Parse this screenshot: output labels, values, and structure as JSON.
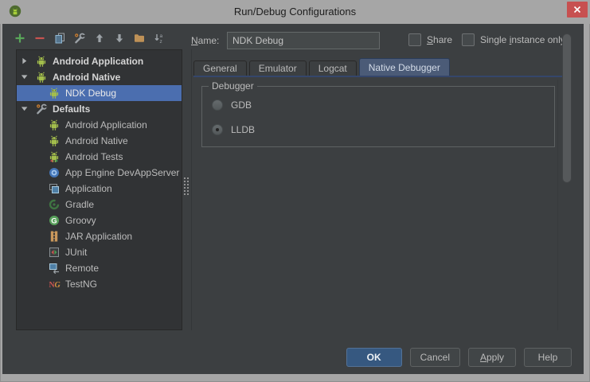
{
  "window": {
    "title": "Run/Debug Configurations"
  },
  "toolbar": {
    "buttons": [
      {
        "name": "add",
        "icon": "add-icon"
      },
      {
        "name": "remove",
        "icon": "remove-icon"
      },
      {
        "name": "copy-configuration",
        "icon": "copy-icon"
      },
      {
        "name": "edit-defaults",
        "icon": "settings-wrench-icon"
      },
      {
        "name": "move-up",
        "icon": "arrow-up-icon"
      },
      {
        "name": "move-down",
        "icon": "arrow-down-icon"
      },
      {
        "name": "new-folder",
        "icon": "folder-icon"
      },
      {
        "name": "sort-alphabetically",
        "icon": "sort-alpha-icon"
      }
    ]
  },
  "tree": {
    "items": [
      {
        "label": "Android Application",
        "icon": "android-icon",
        "bold": true,
        "level": 0,
        "expander": "collapsed",
        "selected": false
      },
      {
        "label": "Android Native",
        "icon": "android-icon",
        "bold": true,
        "level": 0,
        "expander": "expanded",
        "selected": false
      },
      {
        "label": "NDK Debug",
        "icon": "android-icon",
        "bold": false,
        "level": 1,
        "expander": "none",
        "selected": true
      },
      {
        "label": "Defaults",
        "icon": "settings-wrench-icon",
        "bold": true,
        "level": 0,
        "expander": "expanded",
        "selected": false
      },
      {
        "label": "Android Application",
        "icon": "android-icon",
        "bold": false,
        "level": 1,
        "expander": "none",
        "selected": false
      },
      {
        "label": "Android Native",
        "icon": "android-icon",
        "bold": false,
        "level": 1,
        "expander": "none",
        "selected": false
      },
      {
        "label": "Android Tests",
        "icon": "android-tests-icon",
        "bold": false,
        "level": 1,
        "expander": "none",
        "selected": false
      },
      {
        "label": "App Engine DevAppServer",
        "icon": "app-engine-icon",
        "bold": false,
        "level": 1,
        "expander": "none",
        "selected": false
      },
      {
        "label": "Application",
        "icon": "application-icon",
        "bold": false,
        "level": 1,
        "expander": "none",
        "selected": false
      },
      {
        "label": "Gradle",
        "icon": "gradle-icon",
        "bold": false,
        "level": 1,
        "expander": "none",
        "selected": false
      },
      {
        "label": "Groovy",
        "icon": "groovy-icon",
        "bold": false,
        "level": 1,
        "expander": "none",
        "selected": false
      },
      {
        "label": "JAR Application",
        "icon": "jar-icon",
        "bold": false,
        "level": 1,
        "expander": "none",
        "selected": false
      },
      {
        "label": "JUnit",
        "icon": "junit-icon",
        "bold": false,
        "level": 1,
        "expander": "none",
        "selected": false
      },
      {
        "label": "Remote",
        "icon": "remote-icon",
        "bold": false,
        "level": 1,
        "expander": "none",
        "selected": false
      },
      {
        "label": "TestNG",
        "icon": "testng-icon",
        "bold": false,
        "level": 1,
        "expander": "none",
        "selected": false
      }
    ]
  },
  "config": {
    "name_label": {
      "text": "Name:",
      "mnemonic_index": 0
    },
    "name_value": "NDK Debug",
    "checkboxes": [
      {
        "label": "Share",
        "mnemonic_index": 0,
        "checked": false
      },
      {
        "label": "Single instance only",
        "mnemonic_index": 7,
        "checked": false
      }
    ],
    "tabs": {
      "items": [
        {
          "label": "General"
        },
        {
          "label": "Emulator"
        },
        {
          "label": "Logcat"
        },
        {
          "label": "Native Debugger"
        }
      ],
      "active": "Native Debugger"
    },
    "debugger_group": {
      "title": "Debugger",
      "options": [
        {
          "label": "GDB",
          "selected": false
        },
        {
          "label": "LLDB",
          "selected": true
        }
      ]
    }
  },
  "footer": {
    "buttons": [
      {
        "label": "OK",
        "primary": true,
        "mnemonic_index": -1
      },
      {
        "label": "Cancel",
        "primary": false,
        "mnemonic_index": -1
      },
      {
        "label": "Apply",
        "primary": false,
        "mnemonic_index": 0
      },
      {
        "label": "Help",
        "primary": false,
        "mnemonic_index": -1
      }
    ]
  },
  "colors": {
    "titlebar": "#A6A6A6",
    "close_button": "#C75050",
    "dialog_bg": "#3C3F41",
    "panel_bg": "#313335",
    "selection": "#4B6EAF",
    "tab_active": "#4B5B77",
    "primary_button": "#365880",
    "android_green": "#A3BE4C"
  }
}
